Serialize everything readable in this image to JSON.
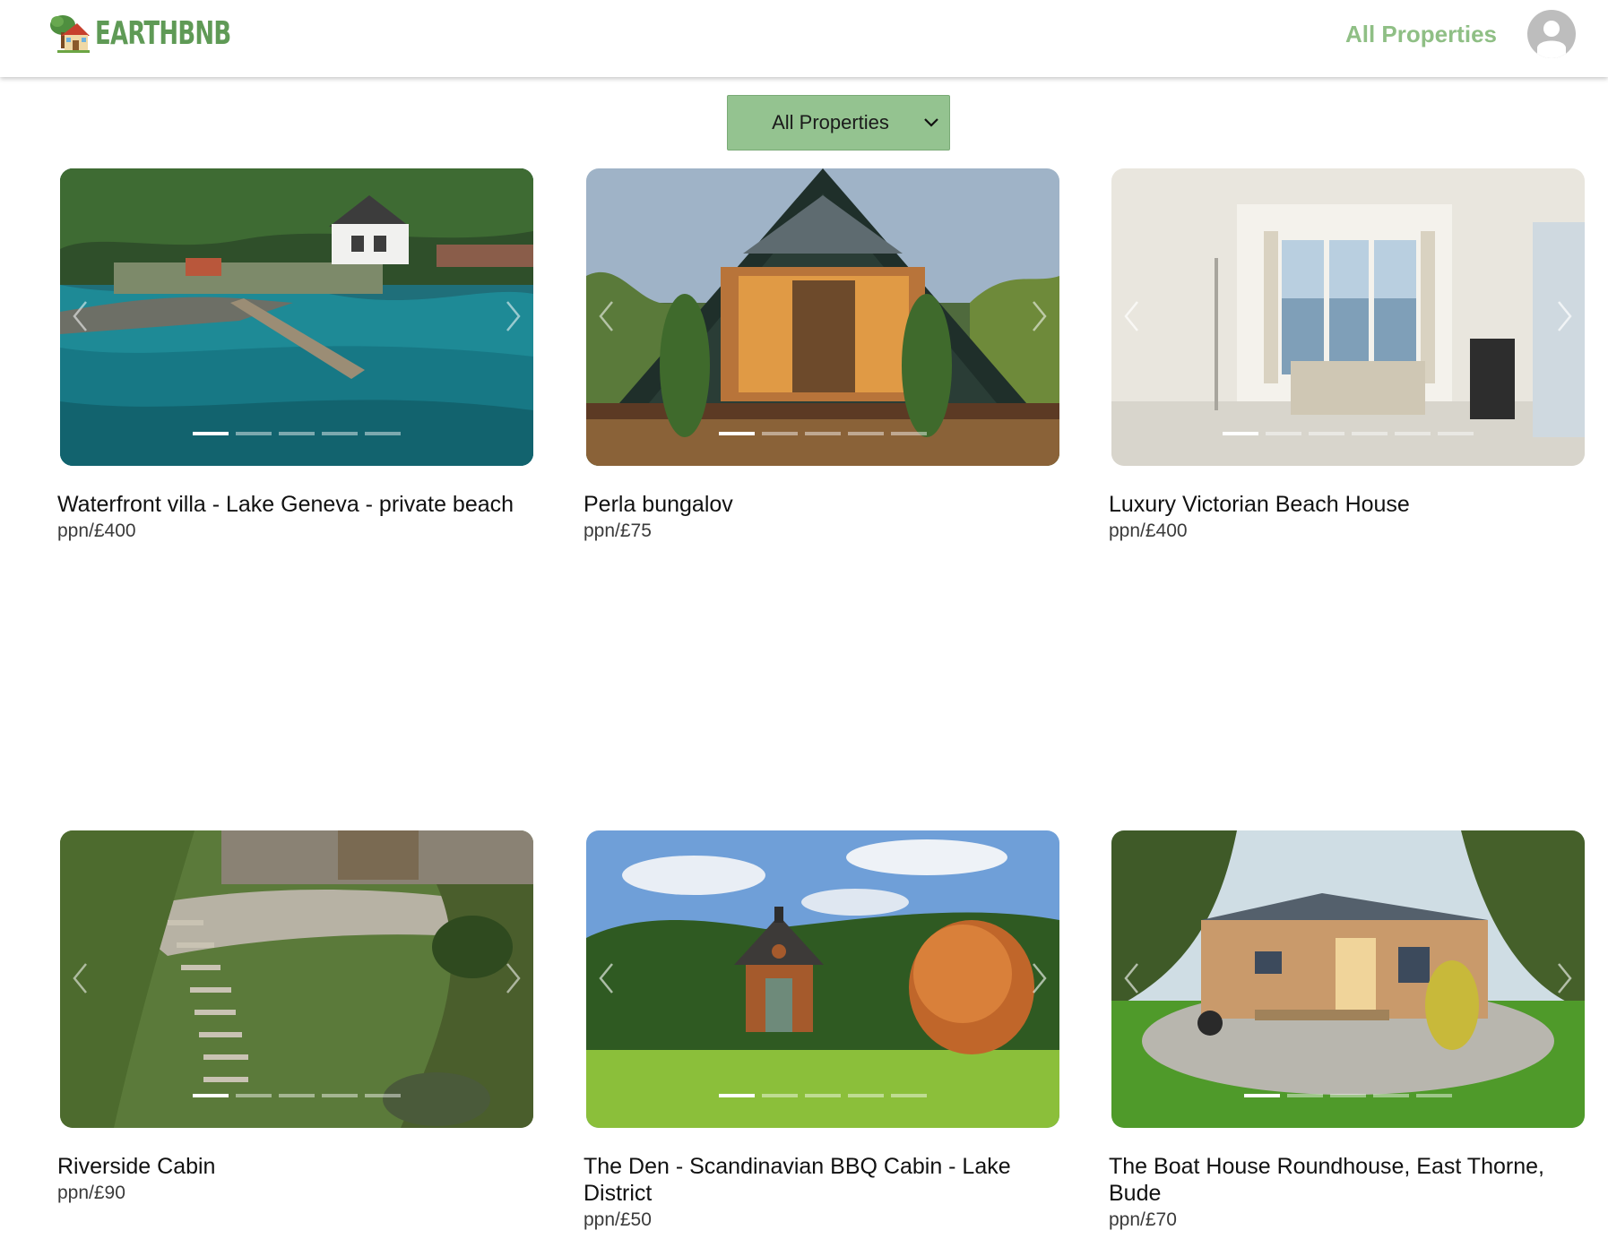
{
  "header": {
    "brand": "EARTHBNB",
    "nav_link": "All Properties"
  },
  "filter": {
    "selected": "All Properties"
  },
  "colors": {
    "brand_green": "#5f9a56",
    "nav_green": "#8fbf85",
    "filter_bg": "#94c390"
  },
  "properties": [
    {
      "title": "Waterfront villa - Lake Geneva - private beach",
      "price": "ppn/£400"
    },
    {
      "title": "Perla bungalov",
      "price": "ppn/£75"
    },
    {
      "title": "Luxury Victorian Beach House",
      "price": "ppn/£400"
    },
    {
      "title": "Riverside Cabin",
      "price": "ppn/£90"
    },
    {
      "title": "The Den - Scandinavian BBQ Cabin - Lake District",
      "price": "ppn/£50"
    },
    {
      "title": "The Boat House Roundhouse, East Thorne, Bude",
      "price": "ppn/£70"
    }
  ],
  "icons": {
    "logo": "house-tree-icon",
    "avatar": "user-avatar-icon",
    "filter": "chevron-down-icon",
    "prev": "chevron-left-icon",
    "next": "chevron-right-icon"
  }
}
